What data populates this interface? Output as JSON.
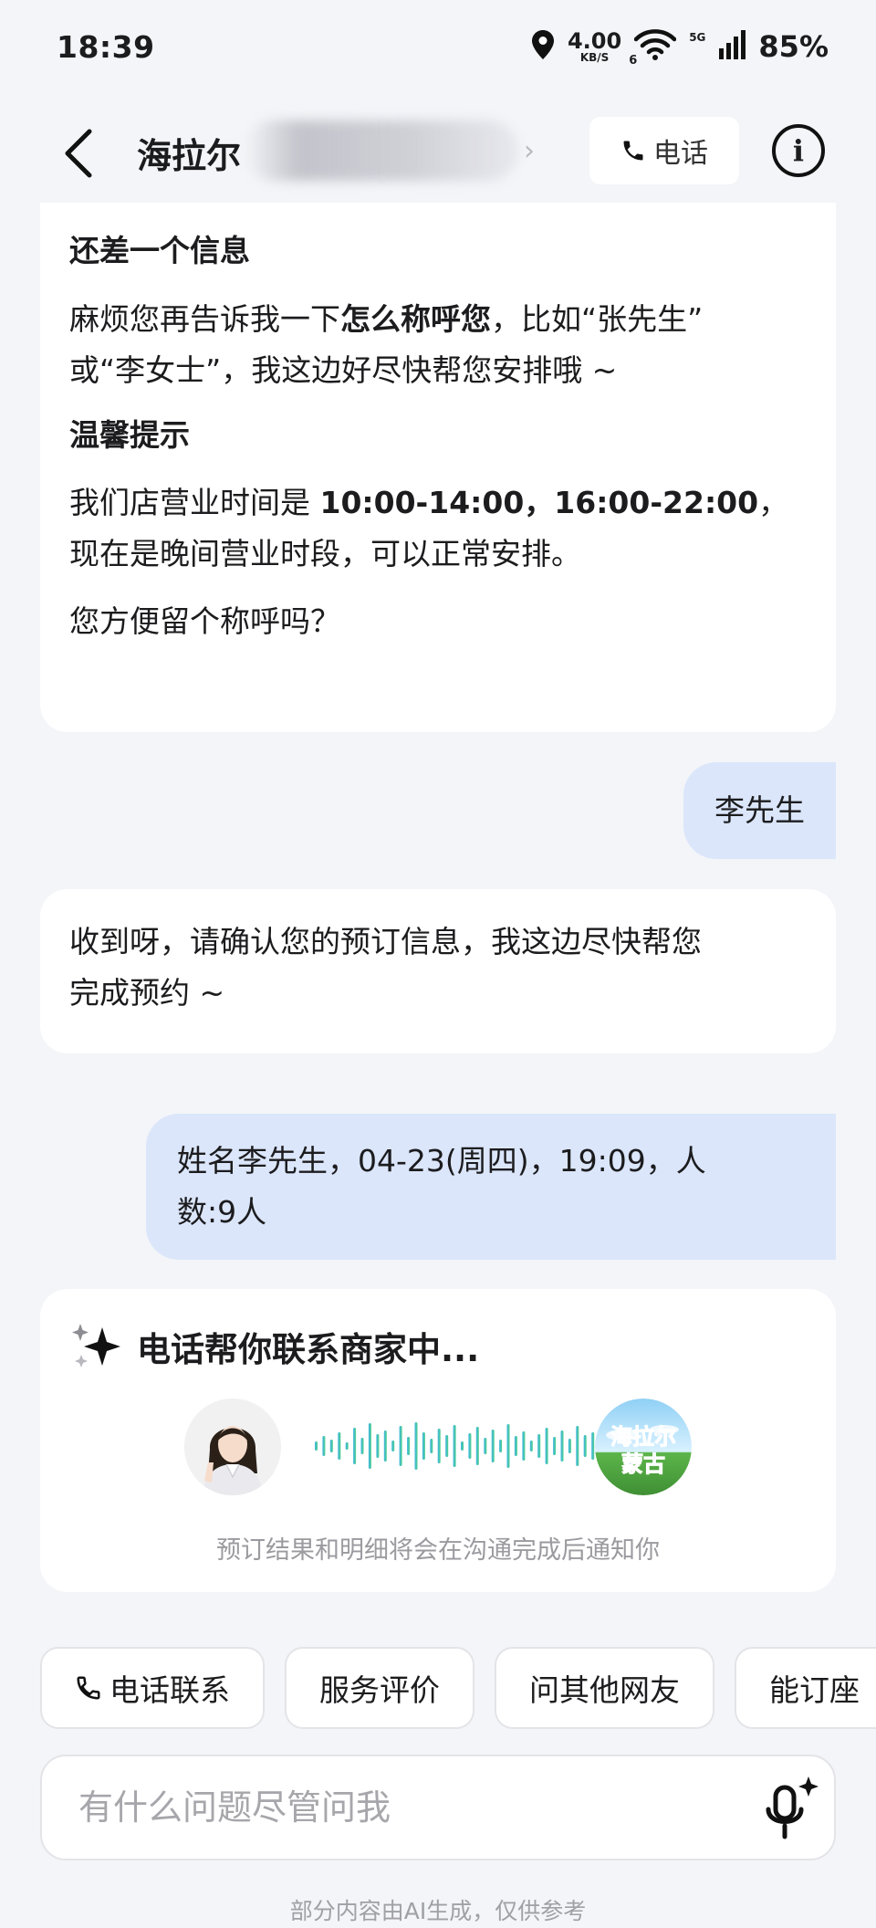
{
  "status_bar": {
    "time": "18:39",
    "net_speed_value": "4.00",
    "net_speed_unit": "KB/S",
    "wifi_label": "6",
    "signal_label": "5G",
    "battery": "85%"
  },
  "nav": {
    "title": "海拉尔",
    "phone_label": "电话"
  },
  "messages": {
    "card1": {
      "heading1": "还差一个信息",
      "p1_before": "麻烦您再告诉我一下",
      "p1_bold": "怎么称呼您",
      "p1_after1": "，比如“张先生”",
      "p1_after2": "或“李女士”，我这边好尽快帮您安排哦 ~",
      "heading2": "温馨提示",
      "p2_before": "我们店营业时间是 ",
      "p2_bold": "10:00-14:00，16:00-22:00",
      "p2_after1": "，",
      "p2_after2": "现在是晚间营业时段，可以正常安排。",
      "p3": "您方便留个称呼吗？"
    },
    "user1": "李先生",
    "card2_line1": "收到呀，请确认您的预订信息，我这边尽快帮您",
    "card2_line2": "完成预约 ~",
    "user2_line1": "姓名李先生，04-23(周四)，19:09，人",
    "user2_line2": "数:9人"
  },
  "call_card": {
    "title": "电话帮你联系商家中...",
    "shop_logo_text1": "海拉尔",
    "shop_logo_text2": "蒙古",
    "note": "预订结果和明细将会在沟通完成后通知你"
  },
  "chips": [
    "电话联系",
    "服务评价",
    "问其他网友",
    "能订座"
  ],
  "input": {
    "placeholder": "有什么问题尽管问我"
  },
  "disclaimer": "部分内容由AI生成，仅供参考",
  "colors": {
    "background": "#f3f5f8",
    "user_bubble": "#dbe6fb",
    "wave_start": "#3fb6e6",
    "wave_end": "#4fd08a"
  }
}
